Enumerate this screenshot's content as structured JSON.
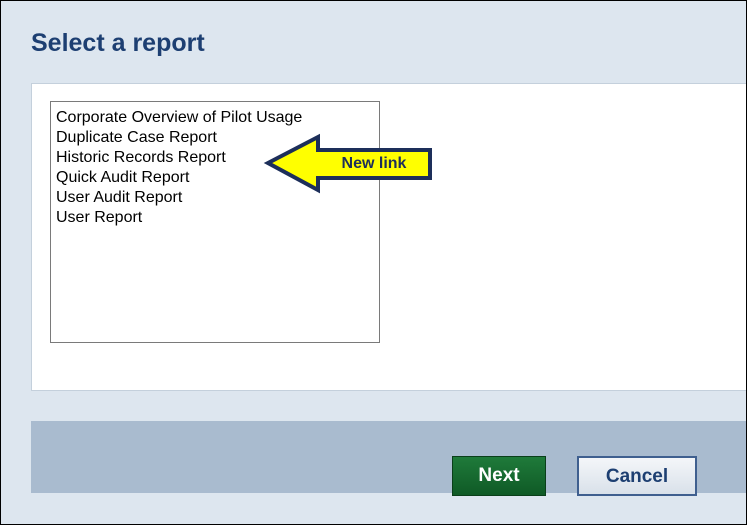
{
  "dialog": {
    "title": "Select a report"
  },
  "reports": [
    "Corporate Overview of Pilot Usage",
    "Duplicate Case Report",
    "Historic Records Report",
    "Quick Audit Report",
    "User Audit Report",
    "User Report"
  ],
  "annotation": {
    "label": "New link",
    "fill_color": "#ffff00",
    "border_color": "#1d2f5a",
    "icon": "left-arrow-icon"
  },
  "buttons": {
    "next_label": "Next",
    "cancel_label": "Cancel"
  },
  "colors": {
    "title": "#1d3f72",
    "next_button": "#1f7a3a",
    "dialog_background": "#dde6ef",
    "footer_background": "#a9bbcf"
  }
}
